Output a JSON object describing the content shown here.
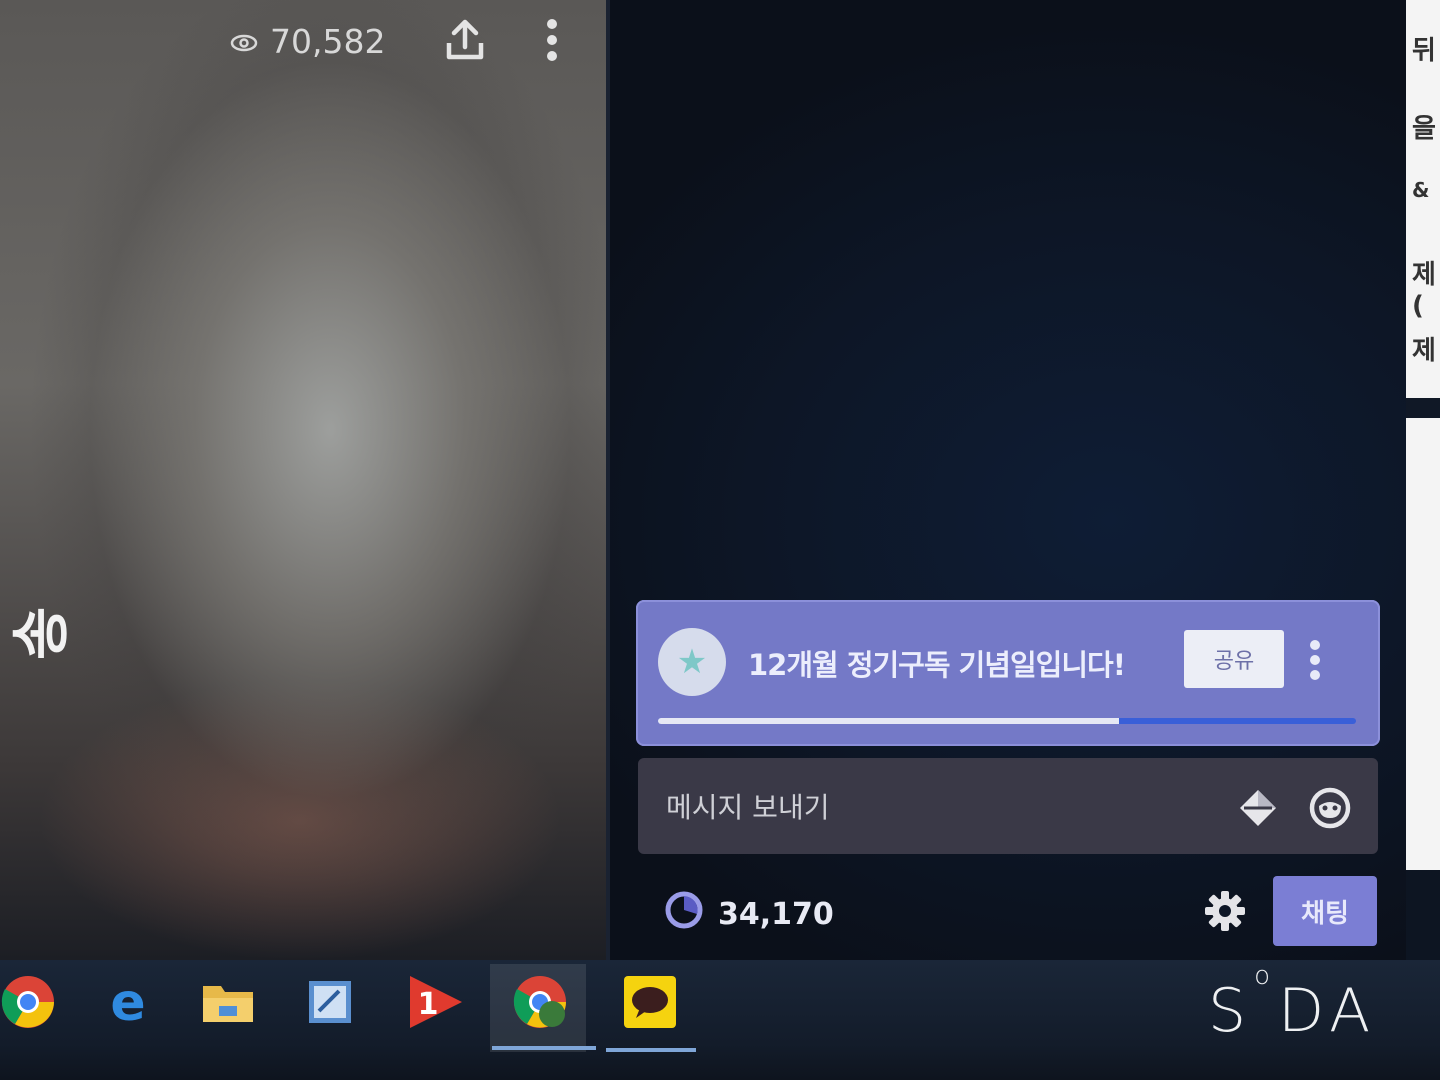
{
  "video": {
    "view_count": "70,582",
    "side_text": "송"
  },
  "notice": {
    "message": "12개월 정기구독 기념일입니다!",
    "share_label": "공유",
    "progress": 0.66
  },
  "chat_input": {
    "placeholder": "메시지 보내기"
  },
  "footer": {
    "points": "34,170",
    "chat_button_label": "채팅"
  },
  "right_strip": {
    "lines": [
      "뒤",
      "을",
      "&",
      "제(",
      "제"
    ]
  },
  "taskbar": {
    "apps": [
      "chrome-icon",
      "edge-icon",
      "file-explorer-icon",
      "notepad-icon",
      "media-player-icon",
      "chrome-beta-icon",
      "kakaotalk-icon"
    ]
  },
  "watermark": {
    "text_a": "S",
    "text_b": "DA"
  },
  "colors": {
    "notice_bg": "#7479c7",
    "chat_button": "#7b7ed4",
    "progress_track": "#3a5fd8"
  }
}
